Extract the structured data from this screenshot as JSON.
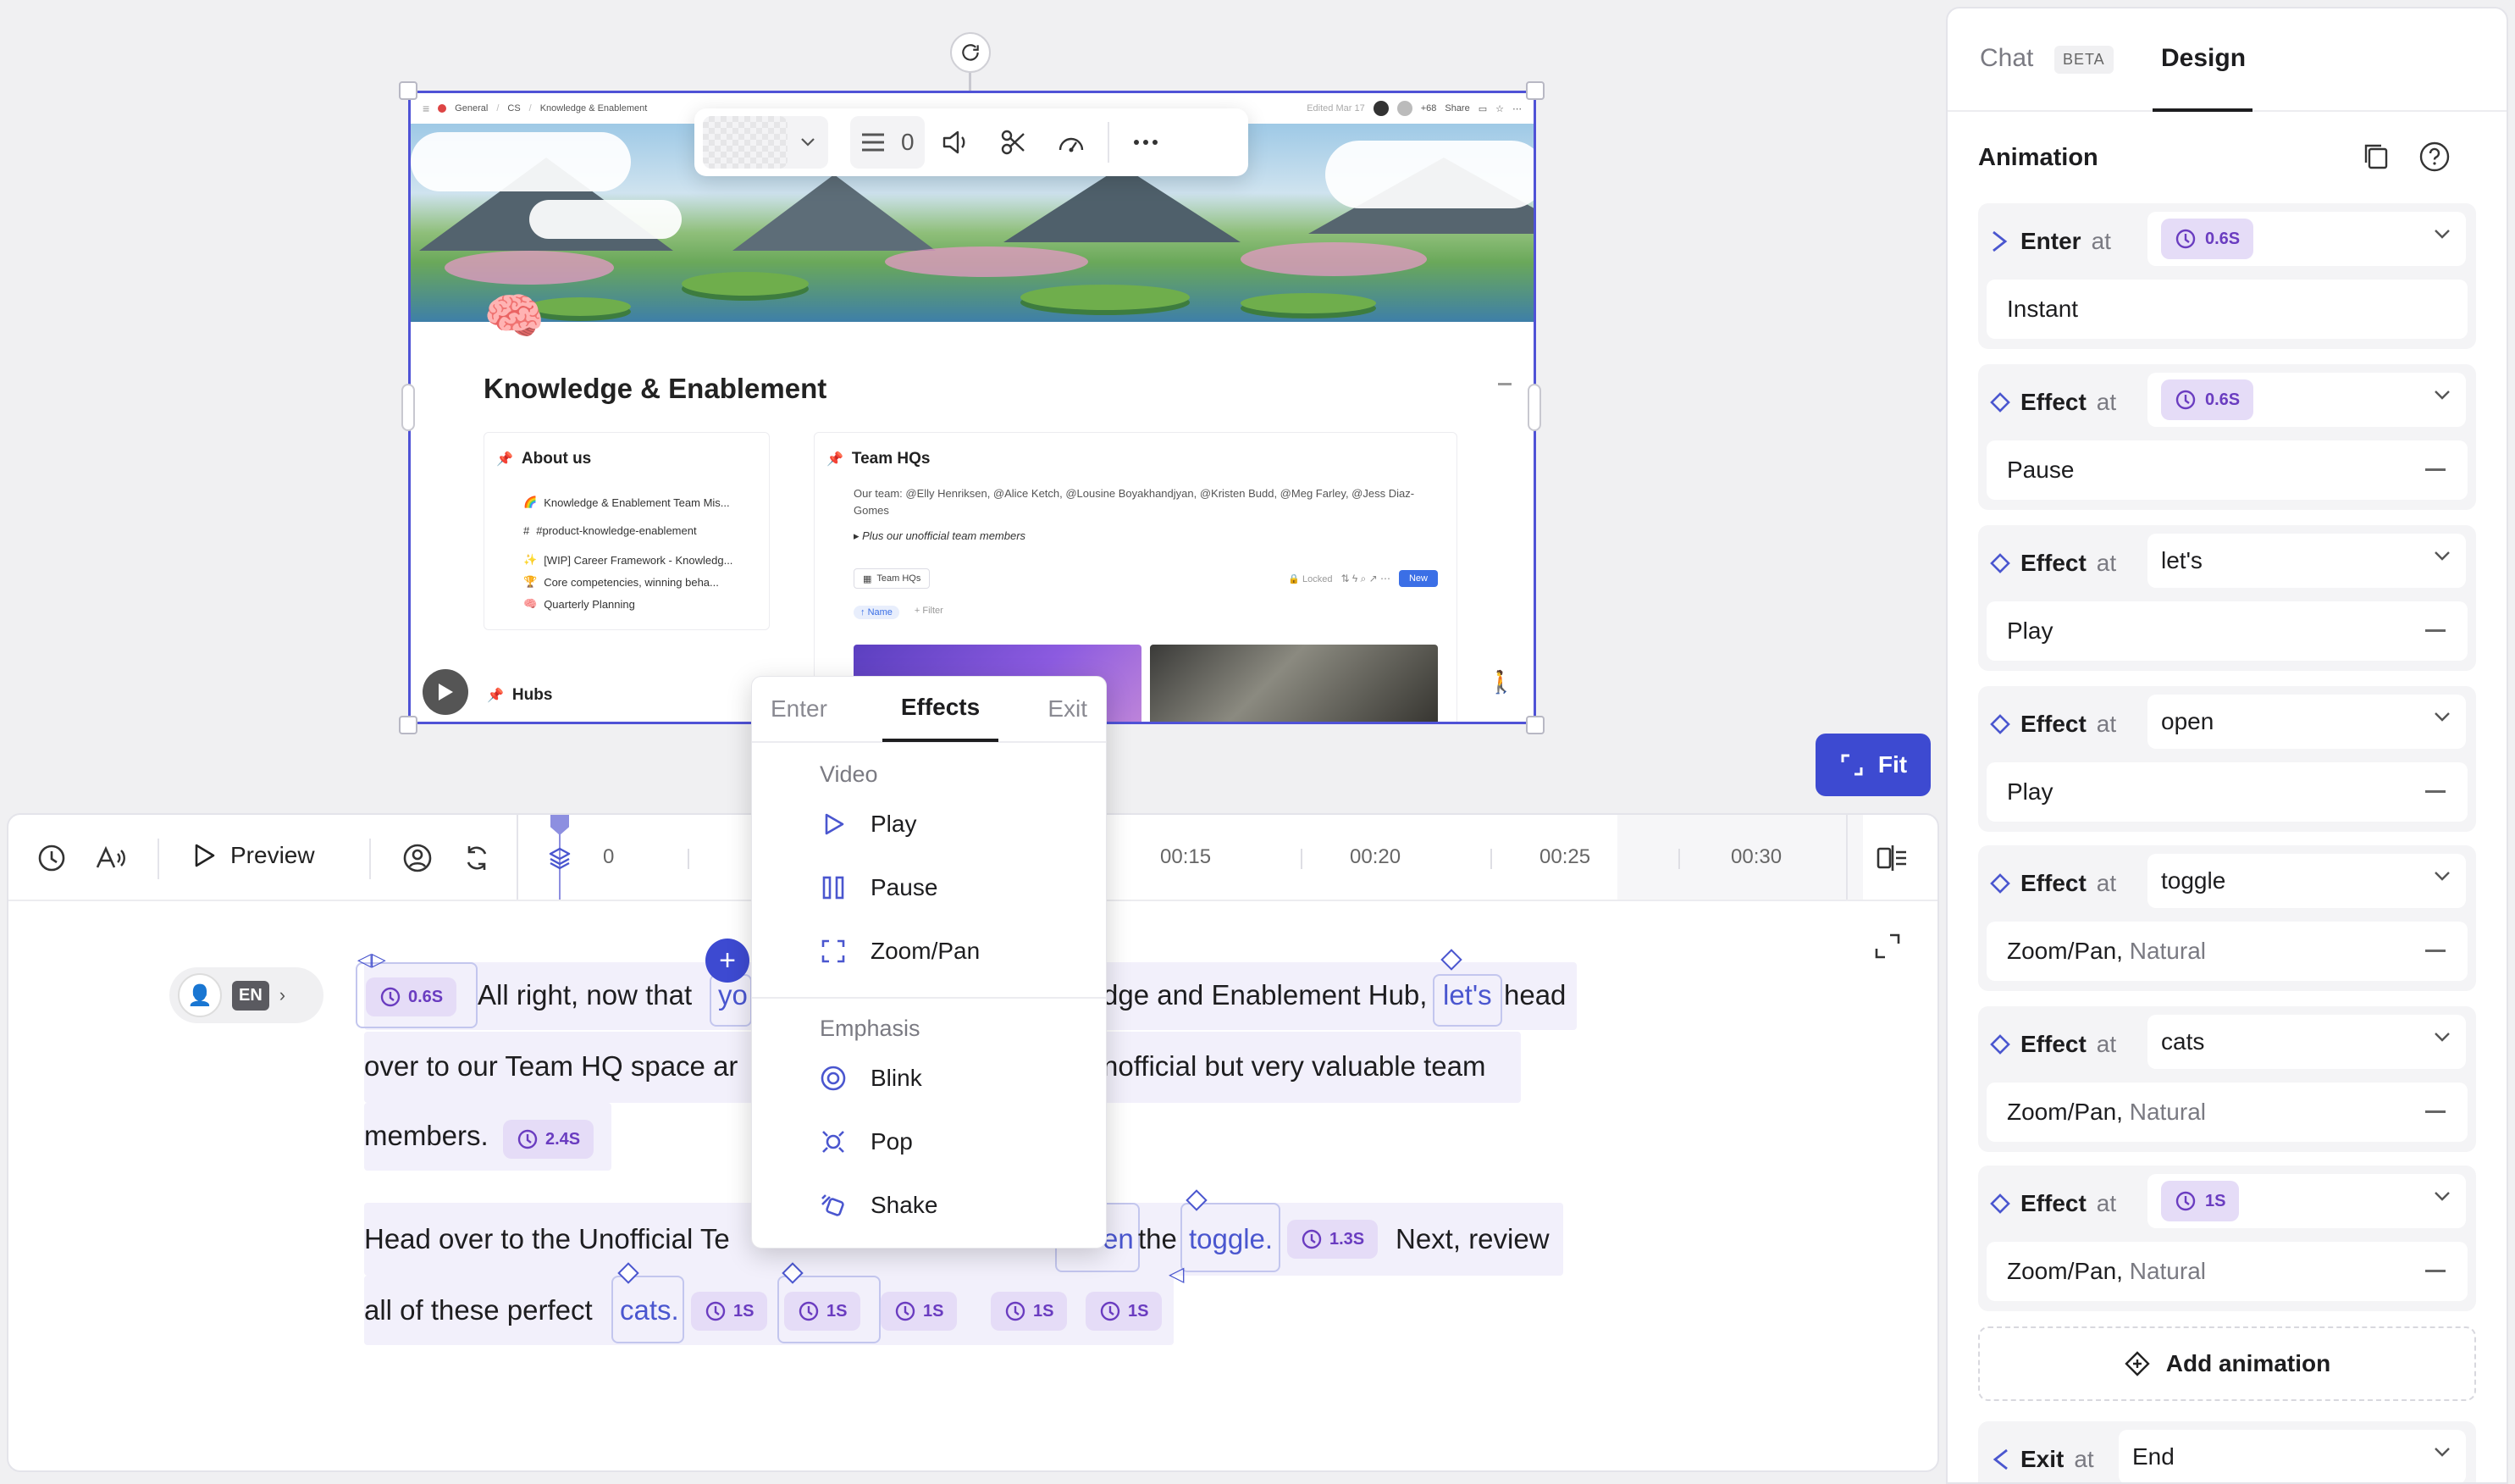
{
  "mini_page": {
    "breadcrumb": [
      "General",
      "CS",
      "Knowledge & Enablement"
    ],
    "edited": "Edited Mar 17",
    "viewer_count": "+68",
    "share_label": "Share",
    "title": "Knowledge & Enablement",
    "about": {
      "heading": "About us",
      "items": [
        "Knowledge & Enablement Team Mis...",
        "#product-knowledge-enablement",
        "[WIP] Career Framework - Knowledg...",
        "Core competencies, winning beha...",
        "Quarterly Planning"
      ]
    },
    "team": {
      "heading": "Team HQs",
      "text": "Our team: @Elly Henriksen, @Alice Ketch, @Lousine Boyakhandjyan, @Kristen Budd, @Meg Farley, @Jess Diaz-Gomes",
      "toggle": "Plus our unofficial team members",
      "db_label": "Team HQs",
      "locked": "Locked",
      "new_label": "New",
      "name_filter": "Name",
      "filter": "+ Filter"
    },
    "hubs_heading": "Hubs"
  },
  "float_toolbar": {
    "count": "0"
  },
  "fit_button": {
    "label": "Fit"
  },
  "editor": {
    "preview_label": "Preview",
    "ruler": {
      "ticks": [
        "0",
        "00:15",
        "00:20",
        "00:25",
        "00:30"
      ]
    },
    "speaker_lang": "EN",
    "transcript": {
      "line1a": "All right, now that",
      "line1b": "yo",
      "line1c": "dge and Enablement Hub,",
      "line1d": "let's",
      "line1e": "head",
      "line2a": "over to our Team HQ space ar",
      "line2b": "nofficial but very valuable team",
      "line3": "members.",
      "line4a": "Head over to the Unofficial Te",
      "line4b": "en",
      "line4c": "the",
      "line4d": "toggle.",
      "line4e": "Next, review",
      "line5a": "all of these perfect",
      "line5b": "cats."
    },
    "chips": {
      "c1": "0.6S",
      "c2": "2.4S",
      "c3": "1.3S",
      "c4": "1S",
      "c5": "1S",
      "c6": "1S",
      "c7": "1S",
      "c8": "1S"
    }
  },
  "popover": {
    "tabs": [
      "Enter",
      "Effects",
      "Exit"
    ],
    "active_tab": "Effects",
    "sections": [
      {
        "title": "Video",
        "items": [
          {
            "label": "Play",
            "icon": "play-icon"
          },
          {
            "label": "Pause",
            "icon": "pause-icon"
          },
          {
            "label": "Zoom/Pan",
            "icon": "zoom-pan-icon"
          }
        ]
      },
      {
        "title": "Emphasis",
        "items": [
          {
            "label": "Blink",
            "icon": "blink-icon"
          },
          {
            "label": "Pop",
            "icon": "pop-icon"
          },
          {
            "label": "Shake",
            "icon": "shake-icon"
          }
        ]
      }
    ]
  },
  "panel": {
    "tabs": {
      "chat": "Chat",
      "beta": "BETA",
      "design": "Design"
    },
    "animation_title": "Animation",
    "at_label": "at",
    "cards": [
      {
        "kind": "Enter",
        "at": "0.6S",
        "at_is_time": true,
        "body": "Instant",
        "body_sub": ""
      },
      {
        "kind": "Effect",
        "at": "0.6S",
        "at_is_time": true,
        "body": "Pause",
        "body_sub": ""
      },
      {
        "kind": "Effect",
        "at": "let's",
        "at_is_time": false,
        "body": "Play",
        "body_sub": ""
      },
      {
        "kind": "Effect",
        "at": "open",
        "at_is_time": false,
        "body": "Play",
        "body_sub": ""
      },
      {
        "kind": "Effect",
        "at": "toggle",
        "at_is_time": false,
        "body": "Zoom/Pan,",
        "body_sub": "Natural"
      },
      {
        "kind": "Effect",
        "at": "cats",
        "at_is_time": false,
        "body": "Zoom/Pan,",
        "body_sub": "Natural"
      },
      {
        "kind": "Effect",
        "at": "1S",
        "at_is_time": true,
        "body": "Zoom/Pan,",
        "body_sub": "Natural"
      }
    ],
    "add_animation": "Add animation",
    "exit": {
      "kind": "Exit",
      "at": "End"
    }
  },
  "colors": {
    "accent": "#3d4ad1",
    "chip_bg": "#e5dcf7",
    "chip_text": "#6a3cc0",
    "selection": "#4f52d6"
  }
}
